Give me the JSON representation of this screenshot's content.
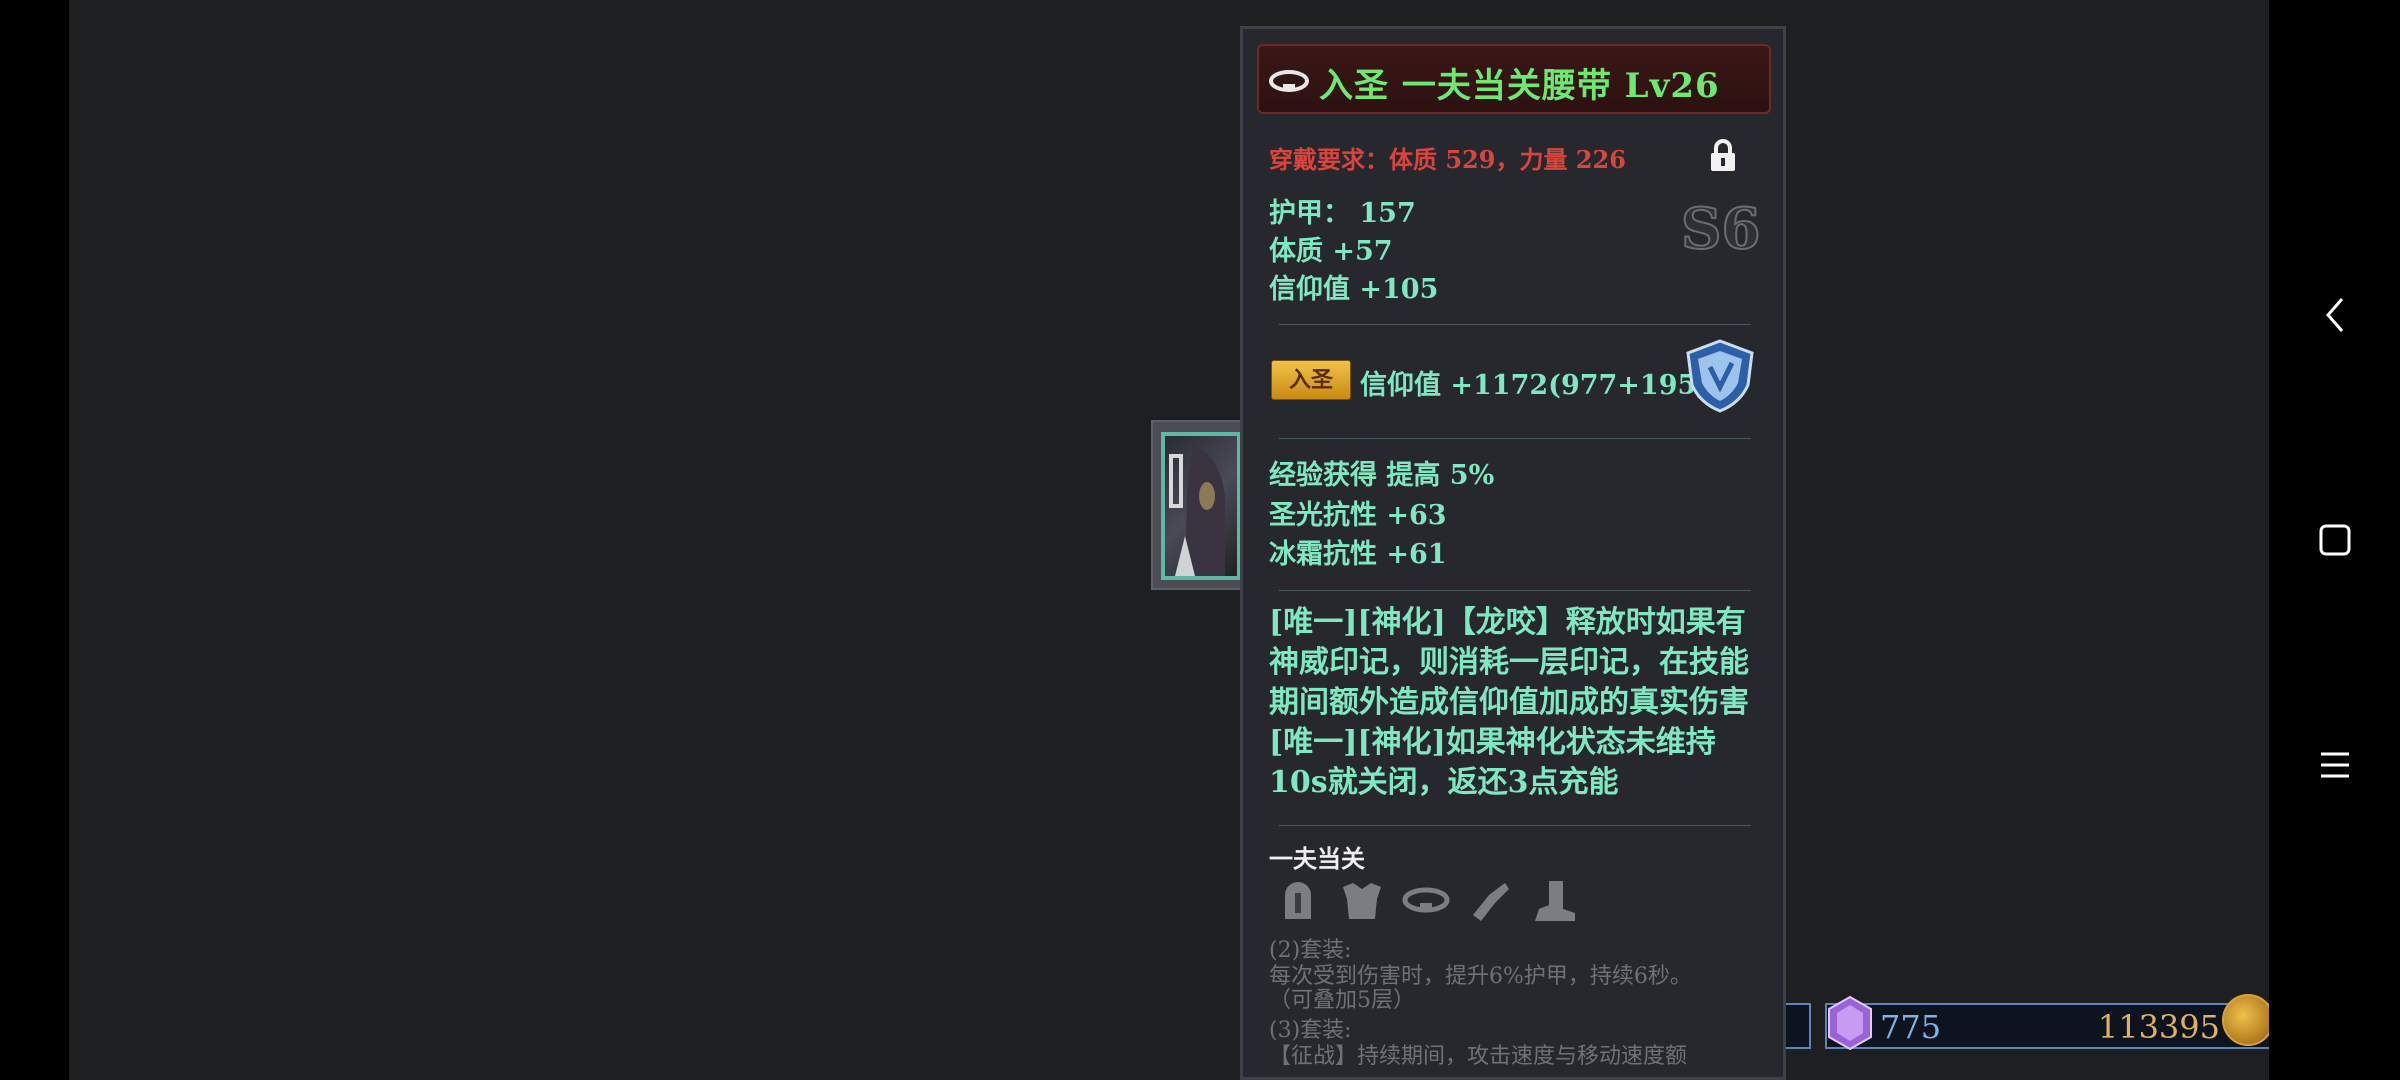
{
  "item": {
    "title": "入圣  一夫当关腰带  Lv26",
    "requirement": "穿戴要求：体质  529，力量  226",
    "grade": "S6",
    "base_stats": [
      "护甲：  157",
      "体质  +57",
      "信仰值  +105"
    ],
    "holy_badge": "入圣",
    "holy_stat": "信仰值  +1172(977+195)",
    "extra_stats": [
      "经验获得  提高  5%",
      "圣光抗性  +63",
      "冰霜抗性  +61"
    ],
    "description": "[唯一][神化]【龙咬】释放时如果有神威印记，则消耗一层印记，在技能期间额外造成信仰值加成的真实伤害[唯一][神化]如果神化状态未维持10s就关闭，返还3点充能",
    "set": {
      "name": "一夫当关",
      "pieces": [
        "helmet-icon",
        "chest-armor-icon",
        "belt-icon",
        "gauntlet-icon",
        "boots-icon"
      ],
      "bonus2_title": "(2)套装:",
      "bonus2_text": "每次受到伤害时，提升6%护甲，持续6秒。",
      "bonus2_note": "（可叠加5层）",
      "bonus3_title": "(3)套装:",
      "bonus3_text": "【征战】持续期间，攻击速度与移动速度额"
    }
  },
  "currency": {
    "gems": "775",
    "gold": "113395"
  },
  "colors": {
    "title_green": "#6fe86f",
    "stat_teal": "#7fe8c0",
    "requirement_red": "#d9453c",
    "badge_gold": "#f2c24a"
  }
}
